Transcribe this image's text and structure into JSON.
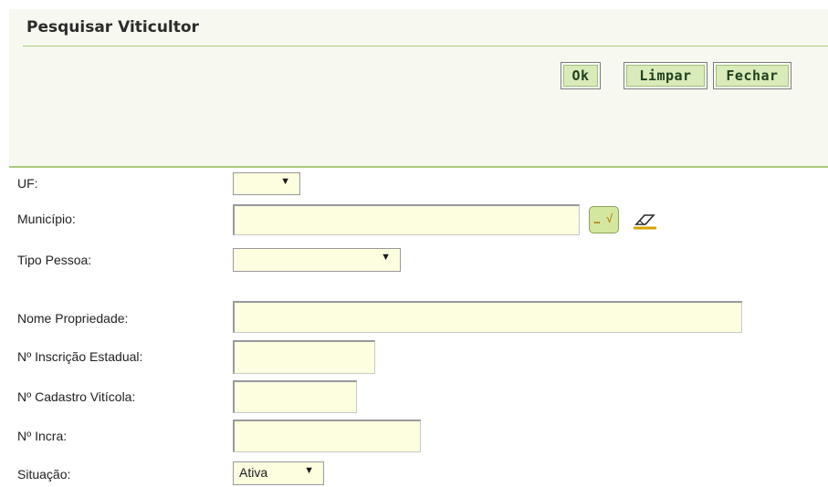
{
  "header": {
    "title": "Pesquisar Viticultor",
    "buttons": {
      "ok": "Ok",
      "limpar": "Limpar",
      "fechar": "Fechar"
    }
  },
  "form": {
    "uf": {
      "label": "UF:",
      "value": ""
    },
    "municipio": {
      "label": "Município:",
      "value": ""
    },
    "tipo_pessoa": {
      "label": "Tipo Pessoa:",
      "value": ""
    },
    "nome_propriedade": {
      "label": "Nome Propriedade:",
      "value": ""
    },
    "inscricao_estadual": {
      "label": "Nº Inscrição Estadual:",
      "value": ""
    },
    "cadastro_viticola": {
      "label": "Nº Cadastro Vitícola:",
      "value": ""
    },
    "incra": {
      "label": "Nº Incra:",
      "value": ""
    },
    "situacao": {
      "label": "Situação:",
      "value": "Ativa"
    }
  },
  "icons": {
    "lookup": "lookup-check-icon",
    "eraser": "eraser-icon",
    "dropdown": "chevron-down-icon"
  },
  "colors": {
    "header_bg": "#f7f9f0",
    "accent_line": "#a9c97c",
    "button_face": "#d9ebb8",
    "field_bg": "#fdfde0"
  }
}
